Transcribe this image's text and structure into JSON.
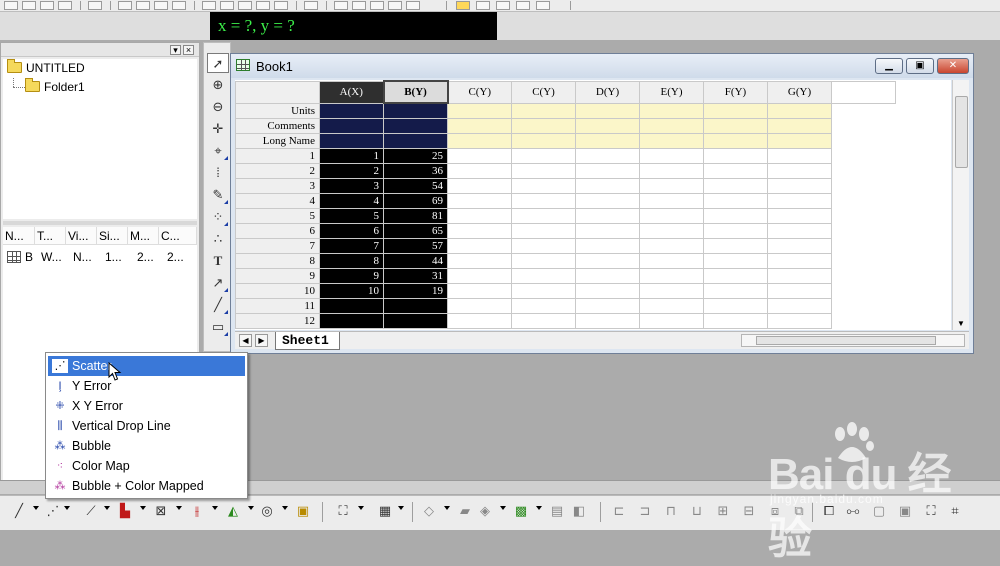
{
  "coord_display": "x = ?, y = ?",
  "project_explorer": {
    "root_folder": "UNTITLED",
    "subfolder": "Folder1",
    "list_columns": [
      "N...",
      "T...",
      "Vi...",
      "Si...",
      "M...",
      "C..."
    ],
    "list_row": [
      "B",
      "W...",
      "N...",
      "1...",
      "2...",
      "2..."
    ]
  },
  "book": {
    "title": "Book1",
    "columns": [
      "A(X)",
      "B(Y)",
      "C(Y)",
      "C(Y)",
      "D(Y)",
      "E(Y)",
      "F(Y)",
      "G(Y)"
    ],
    "meta_rows": [
      "Units",
      "Comments",
      "Long Name"
    ],
    "row_numbers": [
      "1",
      "2",
      "3",
      "4",
      "5",
      "6",
      "7",
      "8",
      "9",
      "10",
      "11",
      "12"
    ],
    "col_a": [
      "1",
      "2",
      "3",
      "4",
      "5",
      "6",
      "7",
      "8",
      "9",
      "10",
      "",
      ""
    ],
    "col_b": [
      "25",
      "36",
      "54",
      "69",
      "81",
      "65",
      "57",
      "44",
      "31",
      "19",
      "",
      ""
    ],
    "sheet_tab": "Sheet1"
  },
  "plot_menu": {
    "items": [
      {
        "label": "Scatter",
        "icon": "scatter-icon",
        "highlighted": true
      },
      {
        "label": "Y Error",
        "icon": "y-error-icon",
        "highlighted": false
      },
      {
        "label": "X Y Error",
        "icon": "xy-error-icon",
        "highlighted": false
      },
      {
        "label": "Vertical Drop Line",
        "icon": "vertical-drop-line-icon",
        "highlighted": false
      },
      {
        "label": "Bubble",
        "icon": "bubble-icon",
        "highlighted": false
      },
      {
        "label": "Color Map",
        "icon": "color-map-icon",
        "highlighted": false
      },
      {
        "label": "Bubble + Color Mapped",
        "icon": "bubble-color-mapped-icon",
        "highlighted": false
      }
    ]
  },
  "watermark": {
    "brand": "Bai du 经验",
    "url": "jingyan.baidu.com"
  },
  "colors": {
    "coord_text": "#3cf04a",
    "selected_column": "#000000",
    "meta_row": "#fbf6c9",
    "menu_highlight": "#3a78d8"
  }
}
